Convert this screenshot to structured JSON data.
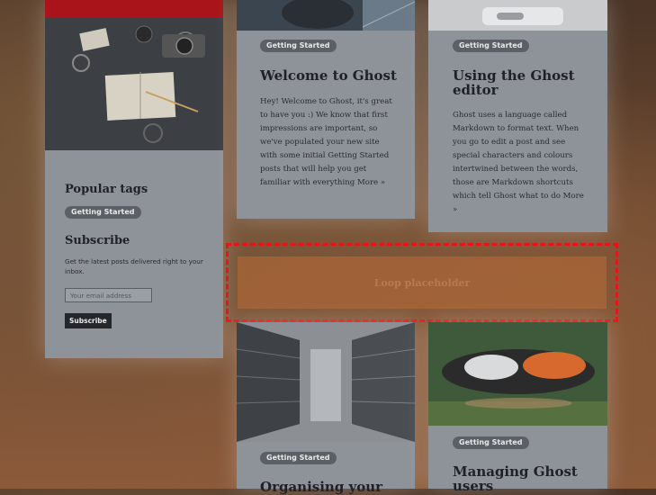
{
  "sidebar": {
    "popular_tags_title": "Popular tags",
    "tag": "Getting Started",
    "subscribe_title": "Subscribe",
    "subscribe_text": "Get the latest posts delivered right to your inbox.",
    "email_placeholder": "Your email address",
    "subscribe_button": "Subscribe"
  },
  "posts": [
    {
      "tag": "Getting Started",
      "title": "Welcome to Ghost",
      "excerpt": "Hey! Welcome to Ghost, it's great to have you :) We know that first impressions are important, so we've populated your new site with some initial Getting Started posts that will help you get familiar with everything More »"
    },
    {
      "tag": "Getting Started",
      "title": "Using the Ghost editor",
      "excerpt": "Ghost uses a language called Markdown to format text. When you go to edit a post and see special characters and colours intertwined between the words, those are Markdown shortcuts which tell Ghost what to do More »"
    },
    {
      "tag": "Getting Started",
      "title": "Organising your"
    },
    {
      "tag": "Getting Started",
      "title": "Managing Ghost users"
    }
  ],
  "loop_placeholder": "Loop placeholder",
  "colors": {
    "accent_red": "#a8141a",
    "card_bg": "#8e9299",
    "dash_red": "#e8141a"
  }
}
